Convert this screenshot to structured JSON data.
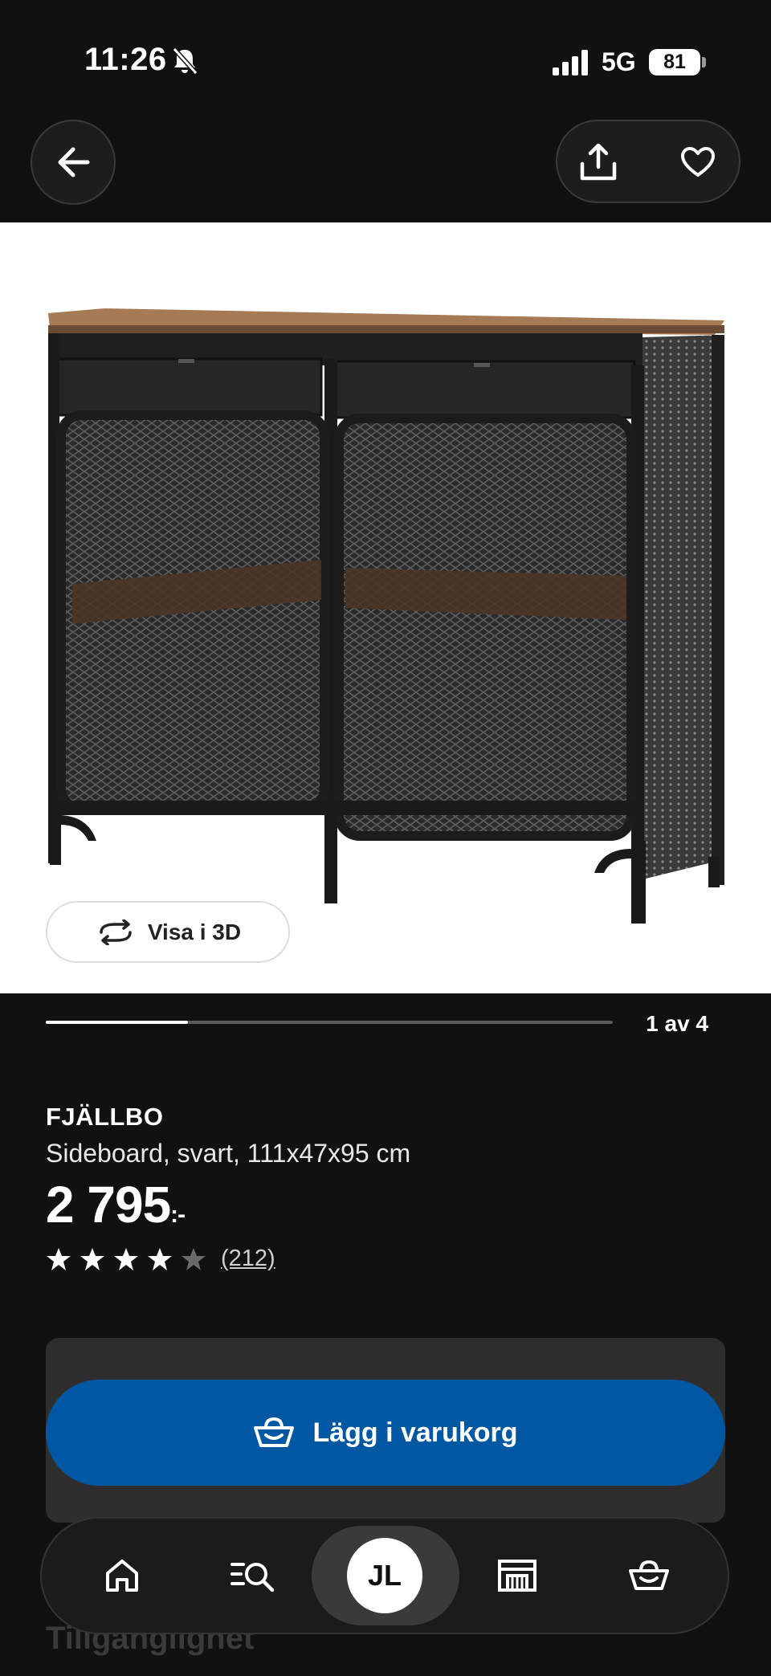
{
  "status_bar": {
    "time": "11:26",
    "network": "5G",
    "battery": "81"
  },
  "nav": {
    "back_icon": "arrow-left-icon",
    "share_icon": "share-icon",
    "favorite_icon": "heart-icon"
  },
  "gallery": {
    "view_3d_label": "Visa i 3D",
    "view_3d_icon": "rotate-icon",
    "page_indicator": "1 av 4",
    "progress_fraction": 0.25
  },
  "product": {
    "name": "FJÄLLBO",
    "description": "Sideboard, svart, 111x47x95 cm",
    "price": "2 795",
    "price_suffix": ":-",
    "rating": 4,
    "rating_max": 5,
    "review_count": "(212)"
  },
  "cart": {
    "add_label": "Lägg i varukorg",
    "icon": "basket-icon",
    "accent_color": "#0058a3"
  },
  "availability": {
    "label": "Tillgänglighet"
  },
  "tab_bar": {
    "items": [
      "home-icon",
      "search-list-icon",
      "profile-avatar",
      "store-icon",
      "basket-icon"
    ],
    "avatar_initials": "JL"
  }
}
